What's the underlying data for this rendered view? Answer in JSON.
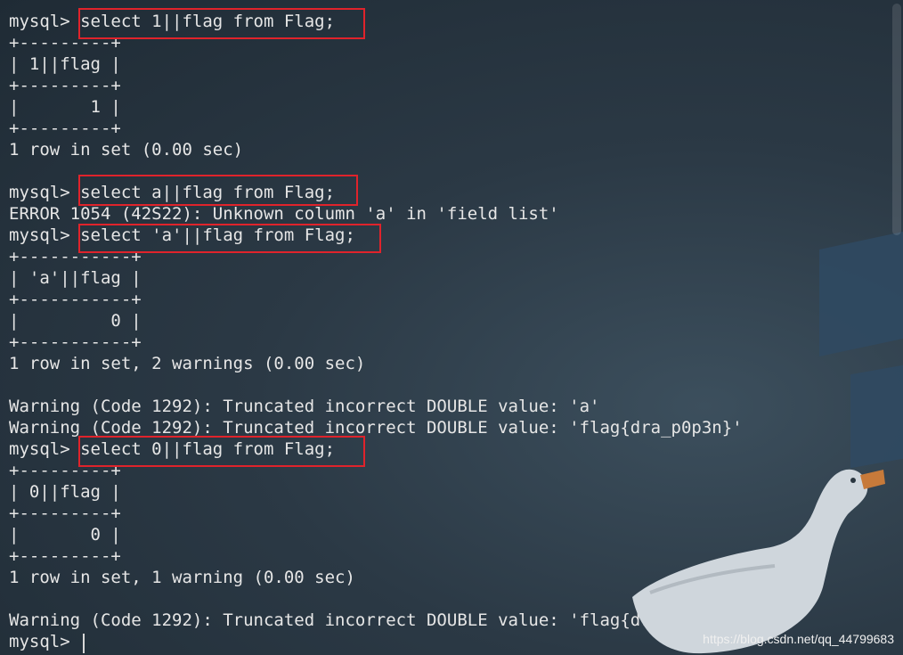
{
  "terminal": {
    "lines": [
      "mysql> select 1||flag from Flag;",
      "+---------+",
      "| 1||flag |",
      "+---------+",
      "|       1 |",
      "+---------+",
      "1 row in set (0.00 sec)",
      "",
      "mysql> select a||flag from Flag;",
      "ERROR 1054 (42S22): Unknown column 'a' in 'field list'",
      "mysql> select 'a'||flag from Flag;",
      "+-----------+",
      "| 'a'||flag |",
      "+-----------+",
      "|         0 |",
      "+-----------+",
      "1 row in set, 2 warnings (0.00 sec)",
      "",
      "Warning (Code 1292): Truncated incorrect DOUBLE value: 'a'",
      "Warning (Code 1292): Truncated incorrect DOUBLE value: 'flag{dra_p0p3n}'",
      "mysql> select 0||flag from Flag;",
      "+---------+",
      "| 0||flag |",
      "+---------+",
      "|       0 |",
      "+---------+",
      "1 row in set, 1 warning (0.00 sec)",
      "",
      "Warning (Code 1292): Truncated incorrect DOUBLE value: 'flag{dra_p0p3n}'",
      "mysql> "
    ]
  },
  "watermark": "https://blog.csdn.net/qq_44799683",
  "colors": {
    "text": "#e6e6e6",
    "highlight_box": "#e0232b",
    "background": "#243240"
  }
}
